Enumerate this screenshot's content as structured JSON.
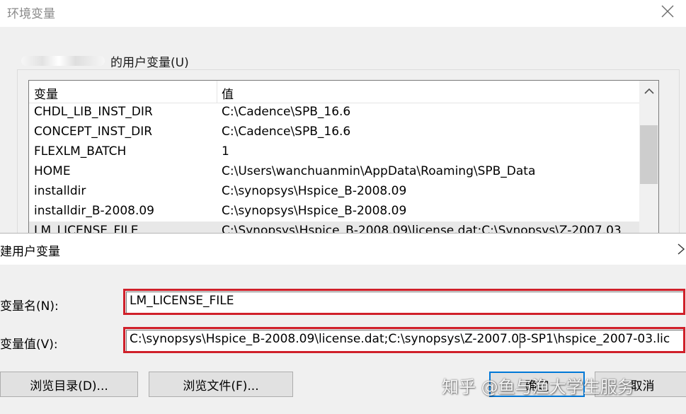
{
  "env_dialog": {
    "title": "环境变量",
    "user_group_label": "的用户变量(U)",
    "columns": {
      "name": "变量",
      "value": "值"
    },
    "rows": [
      {
        "name": "CHDL_LIB_INST_DIR",
        "value": "C:\\Cadence\\SPB_16.6"
      },
      {
        "name": "CONCEPT_INST_DIR",
        "value": "C:\\Cadence\\SPB_16.6"
      },
      {
        "name": "FLEXLM_BATCH",
        "value": "1"
      },
      {
        "name": "HOME",
        "value": "C:\\Users\\wanchuanmin\\AppData\\Roaming\\SPB_Data"
      },
      {
        "name": "installdir",
        "value": "C:\\synopsys\\Hspice_B-2008.09"
      },
      {
        "name": "installdir_B-2008.09",
        "value": "C:\\synopsys\\Hspice_B-2008.09"
      },
      {
        "name": "LM_LICENSE_FILE",
        "value": "C:\\Synopsys\\Hspice_B-2008.09\\license.dat;C:\\Synopsys\\Z-2007.03"
      }
    ]
  },
  "new_var_dialog": {
    "title": "建用户变量",
    "name_label": "变量名(N):",
    "value_label": "变量值(V):",
    "name_value": "LM_LICENSE_FILE",
    "value_value": "C:\\synopsys\\Hspice_B-2008.09\\license.dat;C:\\synopsys\\Z-2007.03-SP1\\hspice_2007-03.lic",
    "buttons": {
      "browse_dir": "浏览目录(D)...",
      "browse_file": "浏览文件(F)...",
      "ok": "确定",
      "cancel": "取消"
    }
  },
  "watermark": "知乎 @鱼与渔大学生服务",
  "colors": {
    "highlight": "#d0202a",
    "default_button_border": "#0078d7",
    "dialog_bg": "#f0f0f0"
  },
  "icons": {
    "close": "close-icon",
    "scroll_up": "chevron-up-icon"
  }
}
